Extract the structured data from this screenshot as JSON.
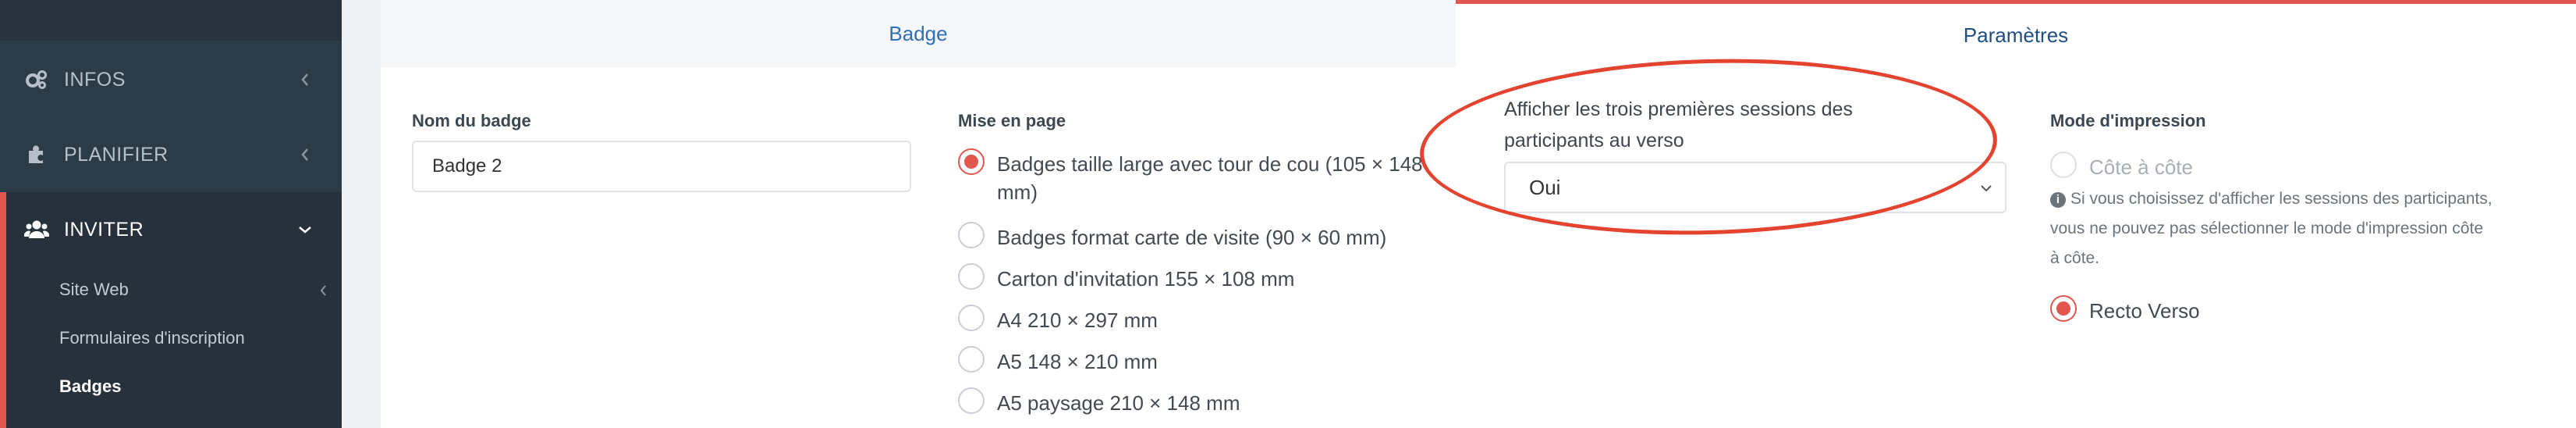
{
  "sidebar": {
    "items": [
      {
        "label": "INFOS",
        "icon": "gears-icon"
      },
      {
        "label": "PLANIFIER",
        "icon": "puzzle-icon"
      },
      {
        "label": "INVITER",
        "icon": "users-icon"
      }
    ],
    "subitems": [
      {
        "label": "Site Web"
      },
      {
        "label": "Formulaires d'inscription"
      },
      {
        "label": "Badges"
      }
    ]
  },
  "tabs": [
    {
      "label": "Badge"
    },
    {
      "label": "Paramètres"
    }
  ],
  "form": {
    "name_label": "Nom du badge",
    "name_value": "Badge 2",
    "layout_label": "Mise en page",
    "layout_options": [
      {
        "label": "Badges taille large avec tour de cou (105 × 148",
        "label2": "mm)",
        "checked": true
      },
      {
        "label": "Badges format carte de visite (90 × 60 mm)",
        "checked": false
      },
      {
        "label": "Carton d'invitation 155 × 108 mm",
        "checked": false
      },
      {
        "label": "A4 210 × 297 mm",
        "checked": false
      },
      {
        "label": "A5 148 × 210 mm",
        "checked": false
      },
      {
        "label": "A5 paysage 210 × 148 mm",
        "checked": false
      }
    ],
    "sessions_label_line1": "Afficher les trois premières sessions des",
    "sessions_label_line2": "participants au verso",
    "sessions_value": "Oui",
    "print_label": "Mode d'impression",
    "print_options": [
      {
        "label": "Côte à côte",
        "checked": false,
        "disabled": true
      },
      {
        "label": "Recto Verso",
        "checked": true,
        "disabled": false
      }
    ],
    "help_line1": "Si vous choisissez d'afficher les sessions des participants,",
    "help_line2": "vous ne pouvez pas sélectionner le mode d'impression côte",
    "help_line3": "à côte."
  },
  "colors": {
    "accent": "#e1564f",
    "sidebar_bg": "#2c3b48",
    "annotation": "#e4432f"
  }
}
